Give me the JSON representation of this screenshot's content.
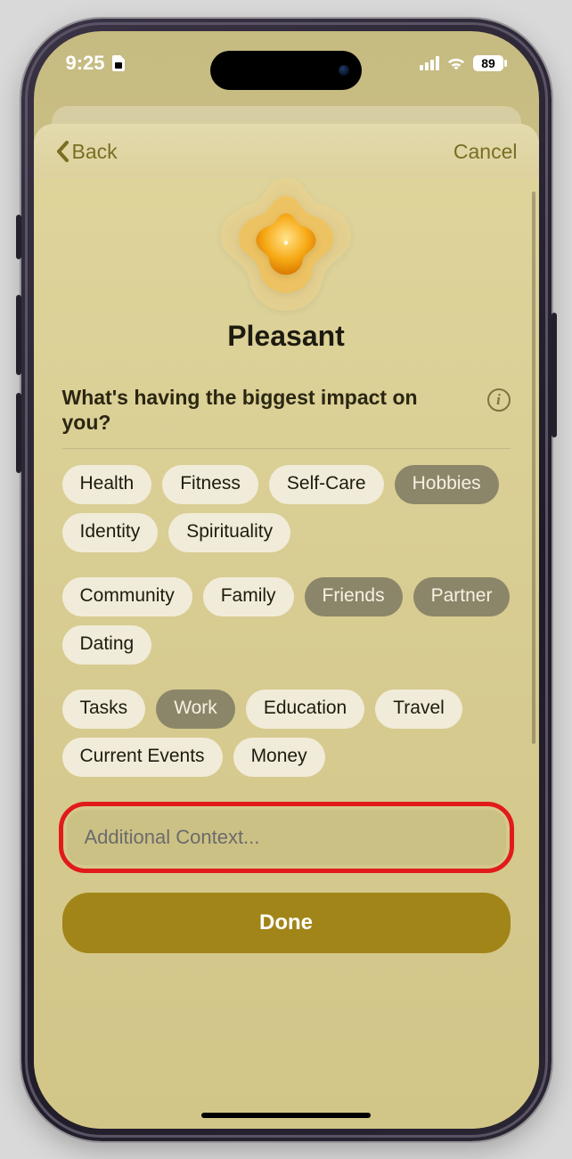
{
  "status": {
    "time": "9:25",
    "battery_pct": "89"
  },
  "nav": {
    "back": "Back",
    "cancel": "Cancel"
  },
  "mood": {
    "label": "Pleasant"
  },
  "question": "What's having the biggest impact on you?",
  "groups": [
    [
      {
        "label": "Health",
        "selected": false
      },
      {
        "label": "Fitness",
        "selected": false
      },
      {
        "label": "Self-Care",
        "selected": false
      },
      {
        "label": "Hobbies",
        "selected": true
      },
      {
        "label": "Identity",
        "selected": false
      },
      {
        "label": "Spirituality",
        "selected": false
      }
    ],
    [
      {
        "label": "Community",
        "selected": false
      },
      {
        "label": "Family",
        "selected": false
      },
      {
        "label": "Friends",
        "selected": true
      },
      {
        "label": "Partner",
        "selected": true
      },
      {
        "label": "Dating",
        "selected": false
      }
    ],
    [
      {
        "label": "Tasks",
        "selected": false
      },
      {
        "label": "Work",
        "selected": true
      },
      {
        "label": "Education",
        "selected": false
      },
      {
        "label": "Travel",
        "selected": false
      },
      {
        "label": "Current Events",
        "selected": false
      },
      {
        "label": "Money",
        "selected": false
      }
    ]
  ],
  "context_placeholder": "Additional Context...",
  "done": "Done"
}
